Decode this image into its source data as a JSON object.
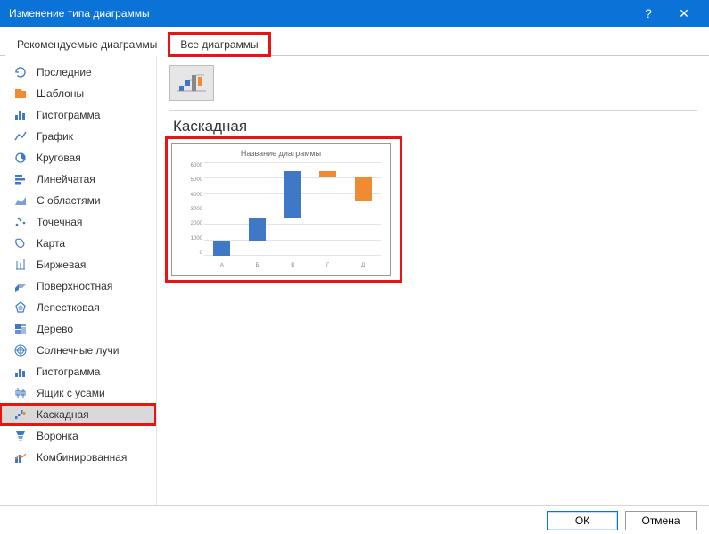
{
  "titlebar": {
    "title": "Изменение типа диаграммы",
    "help": "?",
    "close": "✕"
  },
  "tabs": {
    "recommended": "Рекомендуемые диаграммы",
    "all": "Все диаграммы"
  },
  "sidebar": {
    "items": [
      {
        "label": "Последние"
      },
      {
        "label": "Шаблоны"
      },
      {
        "label": "Гистограмма"
      },
      {
        "label": "График"
      },
      {
        "label": "Круговая"
      },
      {
        "label": "Линейчатая"
      },
      {
        "label": "С областями"
      },
      {
        "label": "Точечная"
      },
      {
        "label": "Карта"
      },
      {
        "label": "Биржевая"
      },
      {
        "label": "Поверхностная"
      },
      {
        "label": "Лепестковая"
      },
      {
        "label": "Дерево"
      },
      {
        "label": "Солнечные лучи"
      },
      {
        "label": "Гистограмма"
      },
      {
        "label": "Ящик с усами"
      },
      {
        "label": "Каскадная"
      },
      {
        "label": "Воронка"
      },
      {
        "label": "Комбинированная"
      }
    ],
    "selected_index": 16
  },
  "main": {
    "chart_type_label": "Каскадная",
    "preview_title": "Название диаграммы"
  },
  "footer": {
    "ok": "ОК",
    "cancel": "Отмена"
  },
  "colors": {
    "accent": "#0b73d8",
    "bar_blue": "#3e78c6",
    "bar_orange": "#ee8b33",
    "highlight": "#e11"
  },
  "chart_data": {
    "type": "bar",
    "title": "Название диаграммы",
    "categories": [
      "А",
      "Б",
      "В",
      "Г",
      "Д"
    ],
    "series": [
      {
        "name": "waterfall",
        "values": [
          {
            "base": 0,
            "top": 1000,
            "color": "blue"
          },
          {
            "base": 1000,
            "top": 2500,
            "color": "blue"
          },
          {
            "base": 2500,
            "top": 5500,
            "color": "blue"
          },
          {
            "base": 5100,
            "top": 5500,
            "color": "orange"
          },
          {
            "base": 3600,
            "top": 5100,
            "color": "orange"
          }
        ]
      }
    ],
    "ylim": [
      0,
      6000
    ],
    "yticks": [
      0,
      1000,
      2000,
      3000,
      4000,
      5000,
      6000
    ],
    "xlabel": "",
    "ylabel": ""
  }
}
